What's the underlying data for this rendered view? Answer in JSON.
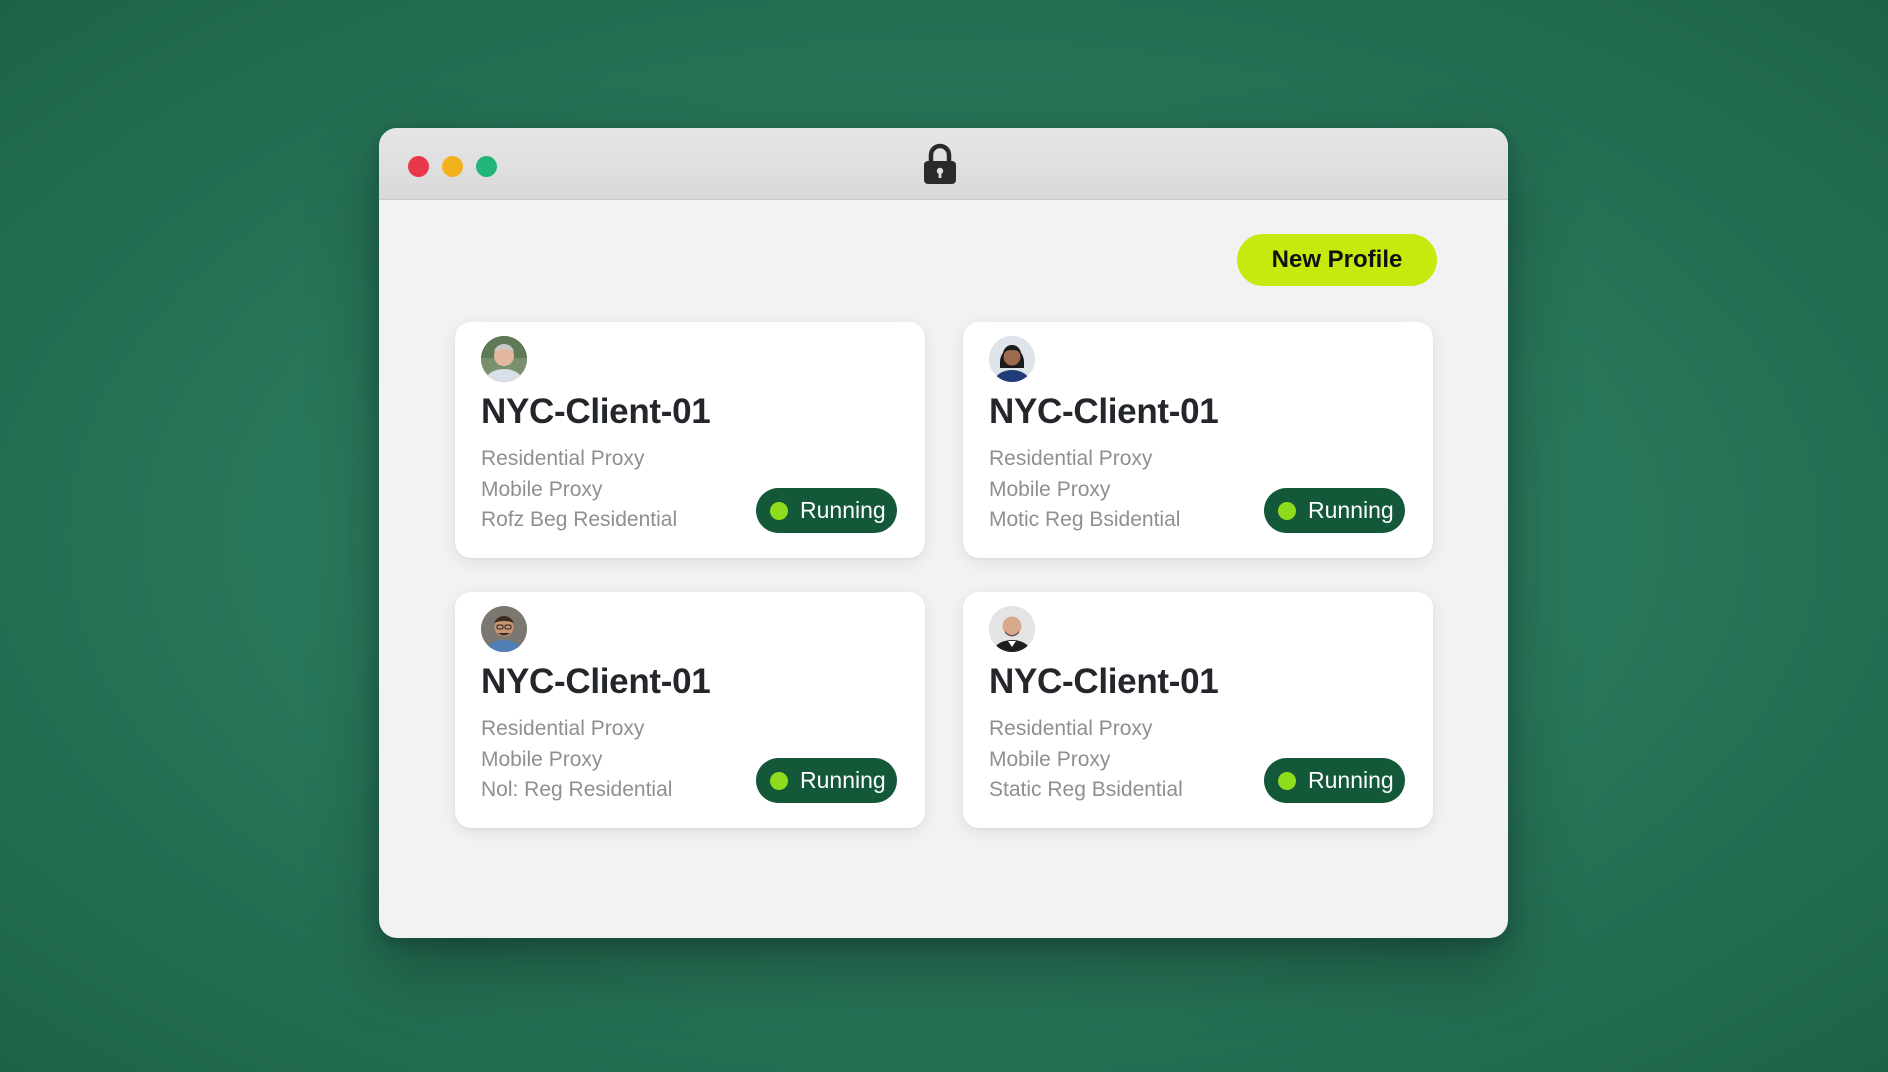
{
  "window": {
    "controls": [
      "close",
      "minimize",
      "maximize"
    ],
    "center_icon": "lock-icon"
  },
  "toolbar": {
    "new_profile_label": "New Profile"
  },
  "colors": {
    "accent": "#c6ea0e",
    "status_badge": "#14583a",
    "status_dot": "#8fdc1c",
    "background": "#2b7a5d"
  },
  "profiles": [
    {
      "name": "NYC-Client-01",
      "avatar": "avatar-older-man",
      "proxies": [
        "Residential Proxy",
        "Mobile Proxy",
        "Rofz Beg Residential"
      ],
      "status": "Running"
    },
    {
      "name": "NYC-Client-01",
      "avatar": "avatar-woman",
      "proxies": [
        "Residential Proxy",
        "Mobile Proxy",
        "Motic Reg Bsidential"
      ],
      "status": "Running"
    },
    {
      "name": "NYC-Client-01",
      "avatar": "avatar-man-glasses",
      "proxies": [
        "Residential Proxy",
        "Mobile Proxy",
        "Nol: Reg Residential"
      ],
      "status": "Running"
    },
    {
      "name": "NYC-Client-01",
      "avatar": "avatar-bald-man",
      "proxies": [
        "Residential Proxy",
        "Mobile Proxy",
        "Static Reg Bsidential"
      ],
      "status": "Running"
    }
  ]
}
